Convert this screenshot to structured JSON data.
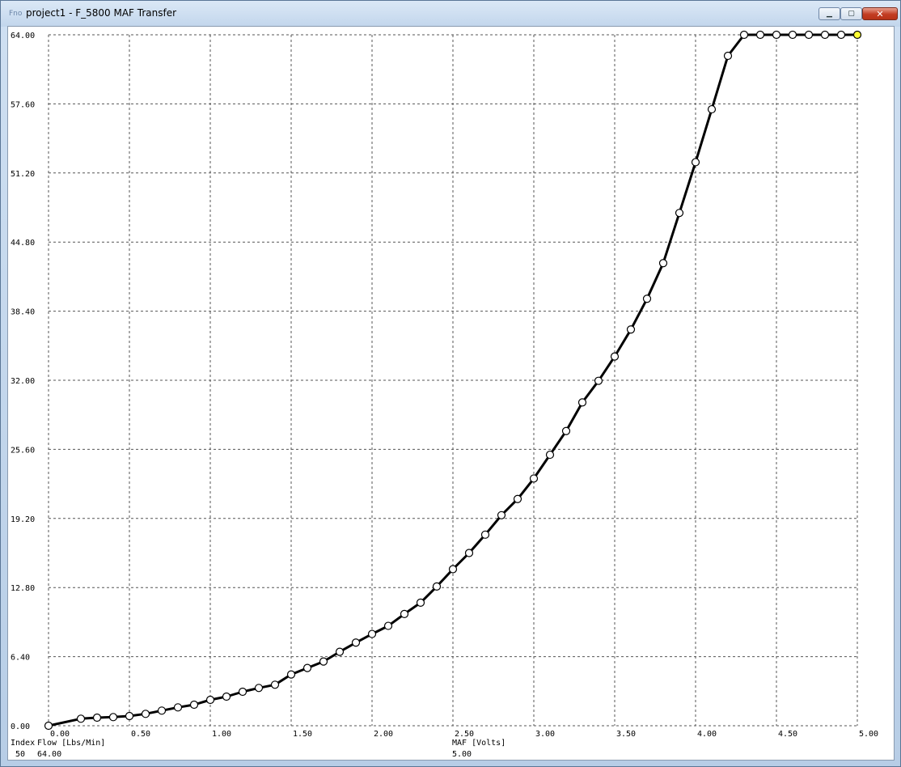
{
  "window": {
    "app_icon_text": "Fno",
    "title": "project1 - F_5800 MAF Transfer",
    "controls": {
      "minimize": "▁",
      "maximize": "▢",
      "close": "✕"
    }
  },
  "chart_data": {
    "type": "line",
    "xlim": [
      0,
      5
    ],
    "ylim": [
      0,
      64
    ],
    "grid": true,
    "x_ticks": [
      "0.00",
      "0.50",
      "1.00",
      "1.50",
      "2.00",
      "2.50",
      "3.00",
      "3.50",
      "4.00",
      "4.50",
      "5.00"
    ],
    "y_ticks": [
      "0.00",
      "6.40",
      "12.80",
      "19.20",
      "25.60",
      "32.00",
      "38.40",
      "44.80",
      "51.20",
      "57.60",
      "64.00"
    ],
    "x": [
      0.0,
      0.2,
      0.3,
      0.4,
      0.5,
      0.6,
      0.7,
      0.8,
      0.9,
      1.0,
      1.1,
      1.2,
      1.3,
      1.4,
      1.5,
      1.6,
      1.7,
      1.8,
      1.9,
      2.0,
      2.1,
      2.2,
      2.3,
      2.4,
      2.5,
      2.6,
      2.7,
      2.8,
      2.9,
      3.0,
      3.1,
      3.2,
      3.3,
      3.4,
      3.5,
      3.6,
      3.7,
      3.8,
      3.9,
      4.0,
      4.1,
      4.2,
      4.3,
      4.4,
      4.5,
      4.6,
      4.7,
      4.8,
      4.9,
      5.0
    ],
    "y": [
      0.0,
      0.65,
      0.75,
      0.8,
      0.9,
      1.1,
      1.4,
      1.7,
      1.95,
      2.4,
      2.7,
      3.15,
      3.5,
      3.8,
      4.75,
      5.35,
      5.95,
      6.85,
      7.7,
      8.5,
      9.25,
      10.35,
      11.4,
      12.9,
      14.5,
      16.0,
      17.7,
      19.5,
      21.0,
      22.9,
      25.1,
      27.3,
      29.95,
      31.95,
      34.2,
      36.7,
      39.55,
      42.85,
      47.5,
      52.2,
      57.1,
      62.05,
      64.0,
      64.0,
      64.0,
      64.0,
      64.0,
      64.0,
      64.0,
      64.0
    ],
    "highlighted_index": 49,
    "status": {
      "index_label": "Index",
      "index_value": "50",
      "y_axis_label": "Flow [Lbs/Min]",
      "y_value": "64.00",
      "x_axis_label": "MAF [Volts]",
      "x_value": "5.00"
    },
    "colors": {
      "line": "#000000",
      "marker_fill": "#ffffff",
      "marker_highlight": "#ffff33",
      "grid": "#555555",
      "text": "#000000"
    }
  }
}
